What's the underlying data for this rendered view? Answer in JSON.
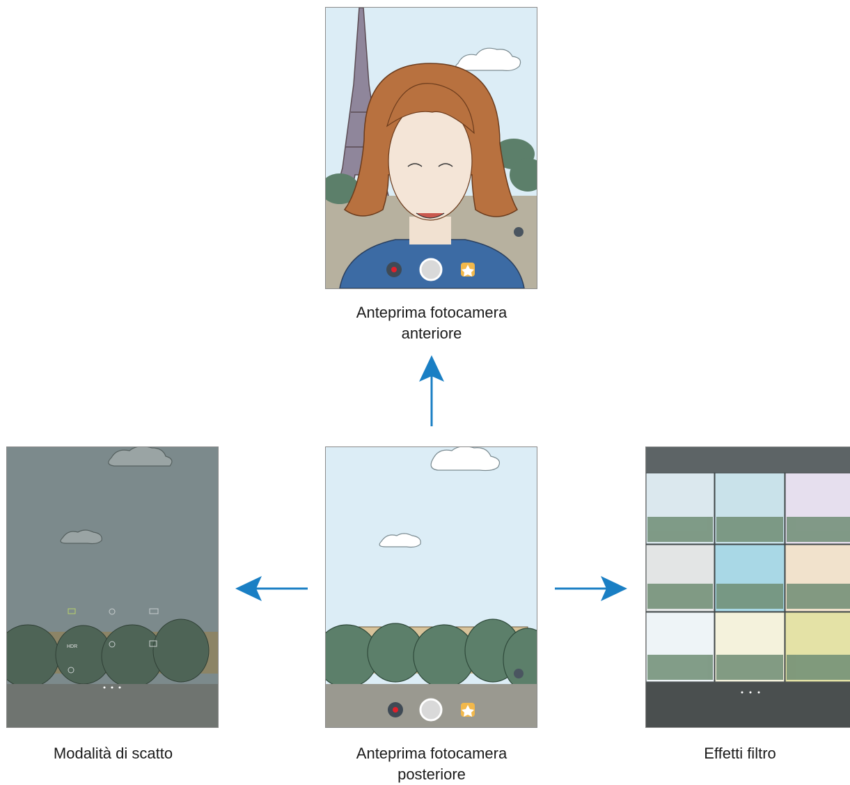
{
  "captions": {
    "front": "Anteprima fotocamera\nanteriore",
    "front_line1": "Anteprima fotocamera",
    "front_line2": "anteriore",
    "rear_line1": "Anteprima fotocamera",
    "rear_line2": "posteriore",
    "modes": "Modalità di scatto",
    "filter": "Effetti filtro"
  },
  "mode_labels": [
    "HDR"
  ],
  "colors": {
    "arrow": "#1a7fc4",
    "sky": "#dcedf6",
    "trees": "#5c7f6a",
    "shutter": "#d9d9d9",
    "record_dot": "#e0202a",
    "star_bg": "#f2b84b",
    "hair": "#b8713f",
    "shirt": "#3c6ba4",
    "modes_overlay": "#7c8a8c",
    "filter_bar": "#5d6466"
  },
  "icons": [
    "arrow-up-icon",
    "arrow-left-icon",
    "arrow-right-icon",
    "record-icon",
    "shutter-icon",
    "star-effect-icon",
    "switch-camera-icon",
    "settings-icon"
  ]
}
